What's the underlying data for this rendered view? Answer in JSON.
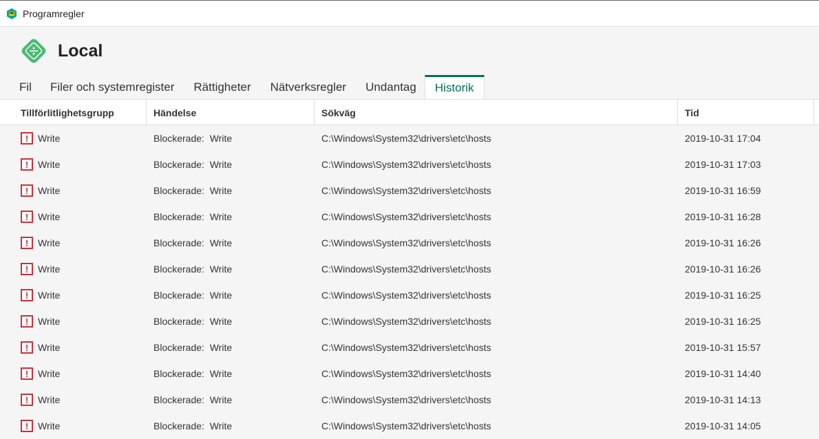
{
  "window": {
    "title": "Programregler"
  },
  "header": {
    "title": "Local"
  },
  "tabs": [
    "Fil",
    "Filer och systemregister",
    "Rättigheter",
    "Nätverksregler",
    "Undantag",
    "Historik"
  ],
  "active_tab": "Historik",
  "columns": [
    "Tillförlitlighetsgrupp",
    "Händelse",
    "Sökväg",
    "Tid"
  ],
  "rows": [
    {
      "group": "Write",
      "event": "Blockerade:  Write",
      "path": "C:\\Windows\\System32\\drivers\\etc\\hosts",
      "time": "2019-10-31 17:04"
    },
    {
      "group": "Write",
      "event": "Blockerade:  Write",
      "path": "C:\\Windows\\System32\\drivers\\etc\\hosts",
      "time": "2019-10-31 17:03"
    },
    {
      "group": "Write",
      "event": "Blockerade:  Write",
      "path": "C:\\Windows\\System32\\drivers\\etc\\hosts",
      "time": "2019-10-31 16:59"
    },
    {
      "group": "Write",
      "event": "Blockerade:  Write",
      "path": "C:\\Windows\\System32\\drivers\\etc\\hosts",
      "time": "2019-10-31 16:28"
    },
    {
      "group": "Write",
      "event": "Blockerade:  Write",
      "path": "C:\\Windows\\System32\\drivers\\etc\\hosts",
      "time": "2019-10-31 16:26"
    },
    {
      "group": "Write",
      "event": "Blockerade:  Write",
      "path": "C:\\Windows\\System32\\drivers\\etc\\hosts",
      "time": "2019-10-31 16:26"
    },
    {
      "group": "Write",
      "event": "Blockerade:  Write",
      "path": "C:\\Windows\\System32\\drivers\\etc\\hosts",
      "time": "2019-10-31 16:25"
    },
    {
      "group": "Write",
      "event": "Blockerade:  Write",
      "path": "C:\\Windows\\System32\\drivers\\etc\\hosts",
      "time": "2019-10-31 16:25"
    },
    {
      "group": "Write",
      "event": "Blockerade:  Write",
      "path": "C:\\Windows\\System32\\drivers\\etc\\hosts",
      "time": "2019-10-31 15:57"
    },
    {
      "group": "Write",
      "event": "Blockerade:  Write",
      "path": "C:\\Windows\\System32\\drivers\\etc\\hosts",
      "time": "2019-10-31 14:40"
    },
    {
      "group": "Write",
      "event": "Blockerade:  Write",
      "path": "C:\\Windows\\System32\\drivers\\etc\\hosts",
      "time": "2019-10-31 14:13"
    },
    {
      "group": "Write",
      "event": "Blockerade:  Write",
      "path": "C:\\Windows\\System32\\drivers\\etc\\hosts",
      "time": "2019-10-31 14:05"
    }
  ],
  "colors": {
    "accent": "#00705a",
    "warning": "#c8303c",
    "logo": "#4cbb74"
  }
}
